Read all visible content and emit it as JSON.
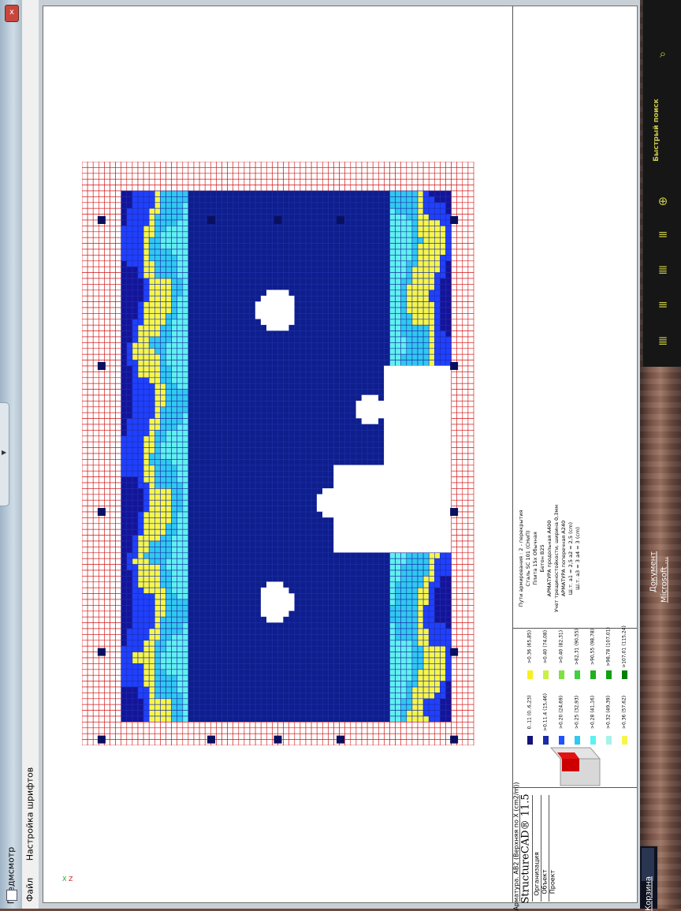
{
  "window": {
    "title": "Предмсмотр",
    "close_label": "x"
  },
  "menu": {
    "items": [
      "Файл",
      "Настройка шрифтов"
    ]
  },
  "sidebar": {
    "search_label": "Быстрый поиск"
  },
  "taskbar": {
    "item_document": "Документ",
    "item_microsoft": "Microsoft ...",
    "item_korzina": "Корзина"
  },
  "stamp": {
    "drawing_title": "Арматура. АВ2 (Верхняя по X (cm2/m))",
    "brand": "StructureCAD® 11.5",
    "org_label": "Организация",
    "object_label": "Объект",
    "project_label": "Проект"
  },
  "legend": {
    "items": [
      {
        "label": "0..11 (0..6,23)",
        "color": "#13137a"
      },
      {
        "label": ">0.11.4 (15,46)",
        "color": "#1c2ba8"
      },
      {
        "label": ">0.20 (24,69)",
        "color": "#2050ff"
      },
      {
        "label": ">0.25 (32,93)",
        "color": "#30c8f0"
      },
      {
        "label": ">0.28 (41,16)",
        "color": "#5ff0f0"
      },
      {
        "label": ">0.32 (49,39)",
        "color": "#a8f2e8"
      },
      {
        "label": ">0.36 (57,62)",
        "color": "#f6f64a"
      },
      {
        "label": ">0.36 (65,85)",
        "color": "#f8f020"
      },
      {
        "label": ">0.40 (74,08)",
        "color": "#c8f048"
      },
      {
        "label": ">0.40 (82,31)",
        "color": "#80e040"
      },
      {
        "label": ">82,31 (90,55)",
        "color": "#40d040"
      },
      {
        "label": ">90,55 (98,78)",
        "color": "#20b020"
      },
      {
        "label": ">98,78 (107,01)",
        "color": "#10a010"
      },
      {
        "label": ">107,01 (115,24)",
        "color": "#008000"
      }
    ],
    "notes": [
      "Пути армирования : 2 - перекрытия",
      "Сталь SC 101 (СНиП)",
      "Плита 15x Обычная",
      "Бетон В25",
      "АРМАТУРА продольная A400",
      "Учет трещиностойкости, ширина 0,3мм",
      "АРМАТУРА поперечная A240",
      "Ш.т. a1 = 2,5 a2 = 2,5 (cm)",
      "Ш.т. a3 = 3 a4 = 3 (cm)"
    ]
  },
  "plot": {
    "axis_labels": [
      "X",
      "Z"
    ]
  }
}
